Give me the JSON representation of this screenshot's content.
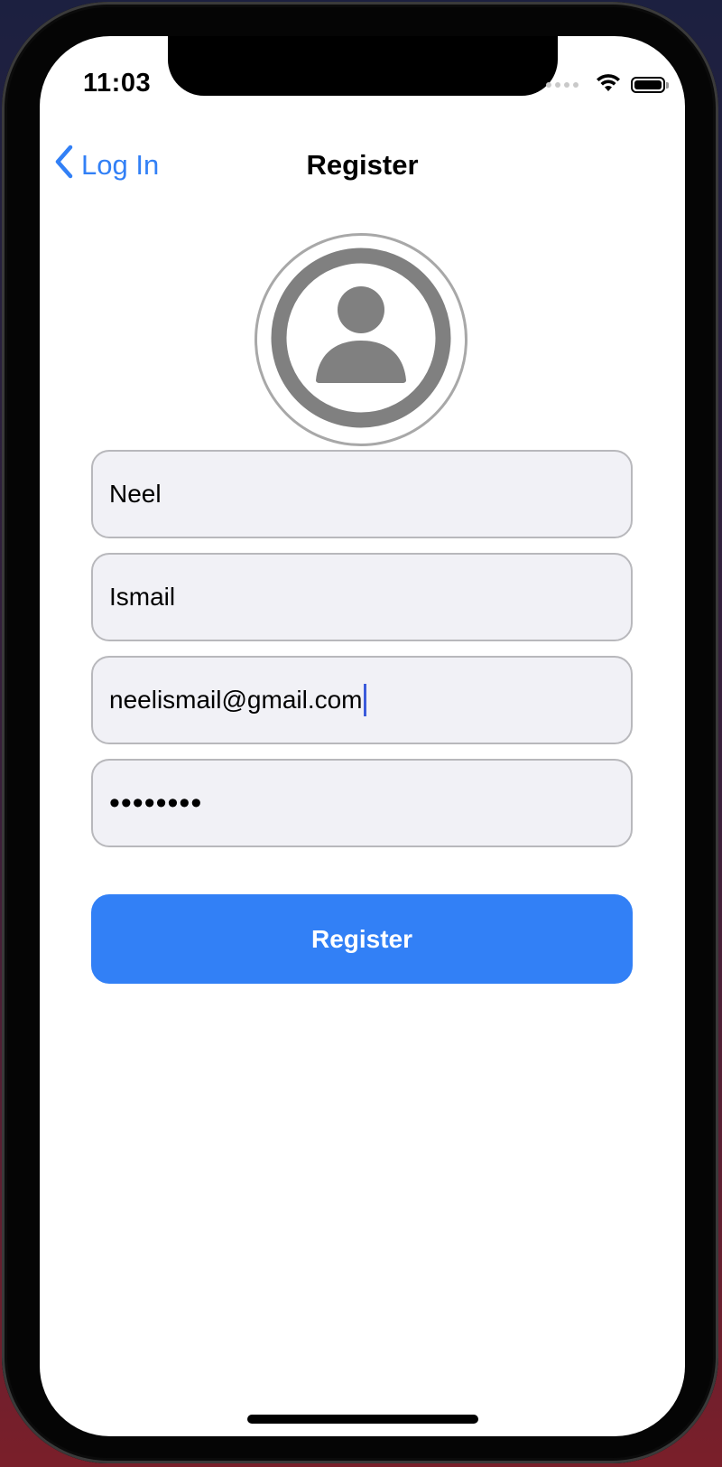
{
  "status_bar": {
    "time": "11:03"
  },
  "nav": {
    "back_label": "Log In",
    "title": "Register"
  },
  "avatar": {
    "icon": "person-circle-icon"
  },
  "form": {
    "first_name": "Neel",
    "last_name": "Ismail",
    "email": "neelismail@gmail.com",
    "password_masked": "••••••••"
  },
  "register_button": {
    "label": "Register"
  },
  "colors": {
    "accent": "#3280f6",
    "field_background": "#f1f1f6",
    "field_border": "#b8b8bc",
    "avatar_gray": "#808080"
  }
}
